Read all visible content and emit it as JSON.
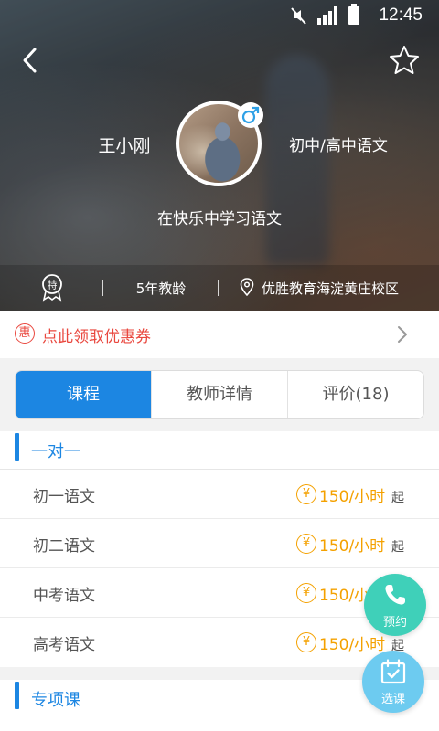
{
  "status_bar": {
    "time": "12:45",
    "icons": [
      "mute-icon",
      "signal-icon",
      "battery-icon"
    ]
  },
  "header": {
    "back_icon": "chevron-left-icon",
    "favorite_icon": "star-outline-icon",
    "teacher_name": "王小刚",
    "subject": "初中/高中语文",
    "gender_icon": "male-icon",
    "motto": "在快乐中学习语文",
    "badge_label": "特",
    "experience": "5年教龄",
    "campus": "优胜教育海淀黄庄校区"
  },
  "coupon": {
    "icon_label": "惠",
    "text": "点此领取优惠券"
  },
  "tabs": [
    {
      "label": "课程",
      "active": true
    },
    {
      "label": "教师详情",
      "active": false
    },
    {
      "label": "评价(18)",
      "active": false
    }
  ],
  "sections": {
    "one_on_one": {
      "title": "一对一",
      "courses": [
        {
          "name": "初一语文",
          "price": "150/小时",
          "suffix": "起",
          "currency_icon": "¥"
        },
        {
          "name": "初二语文",
          "price": "150/小时",
          "suffix": "起",
          "currency_icon": "¥"
        },
        {
          "name": "中考语文",
          "price": "150/小时",
          "suffix": "起",
          "currency_icon": "¥"
        },
        {
          "name": "高考语文",
          "price": "150/小时",
          "suffix": "起",
          "currency_icon": "¥"
        }
      ]
    },
    "special": {
      "title": "专项课"
    }
  },
  "fab": {
    "book_label": "预约",
    "select_label": "选课"
  },
  "colors": {
    "accent": "#1c86e2",
    "coupon": "#e9473e",
    "price": "#f4a100",
    "fab_book": "#3fd0b9",
    "fab_select": "#6dcbf0"
  }
}
